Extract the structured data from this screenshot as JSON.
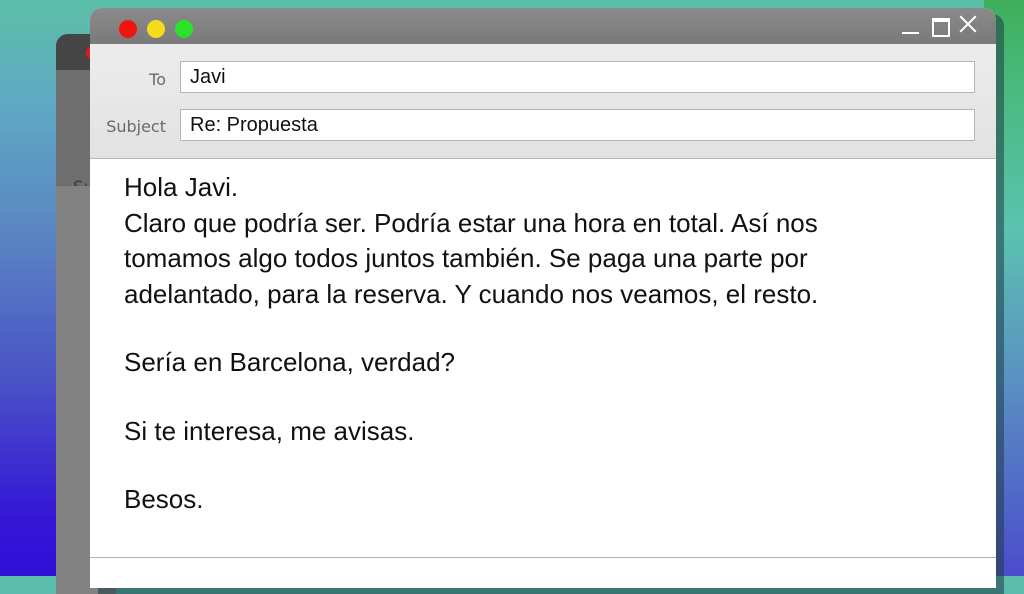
{
  "background_window": {
    "partial_label": "Su"
  },
  "window": {
    "controls": {
      "close_dot": "close-dot",
      "minimize_dot": "minimize-dot",
      "zoom_dot": "zoom-dot",
      "icons": [
        "minimize-icon",
        "maximize-icon",
        "close-icon"
      ]
    },
    "colors": {
      "red": "#f0150f",
      "yellow": "#f2dc1c",
      "green": "#2de12a"
    }
  },
  "compose": {
    "to_label": "To",
    "to_value": "Javi",
    "subject_label": "Subject",
    "subject_value": "Re: Propuesta",
    "body": {
      "greeting": "Hola Javi.",
      "paragraph_lines": [
        "Claro que podría ser. Podría estar una hora en total. Así nos",
        "tomamos algo todos juntos también. Se paga una parte por",
        "adelantado, para la reserva. Y cuando nos veamos, el resto."
      ],
      "question": "Sería en Barcelona, verdad?",
      "request": "Si te interesa, me avisas.",
      "signoff": "Besos."
    }
  }
}
